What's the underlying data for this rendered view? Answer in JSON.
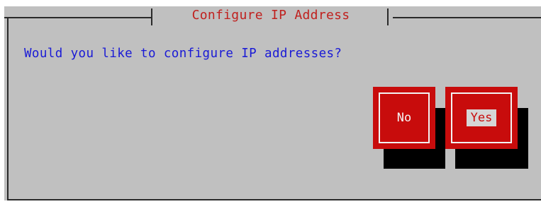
{
  "dialog": {
    "title": "Configure IP Address",
    "prompt": "Would you like to configure IP addresses?"
  },
  "buttons": {
    "no_label": "No",
    "yes_label": "Yes",
    "focused": "yes"
  },
  "colors": {
    "background": "#c0c0c0",
    "title_text": "#c0201e",
    "prompt_text": "#1a1ad6",
    "button": "#c80c0c",
    "button_shadow": "#000000"
  }
}
